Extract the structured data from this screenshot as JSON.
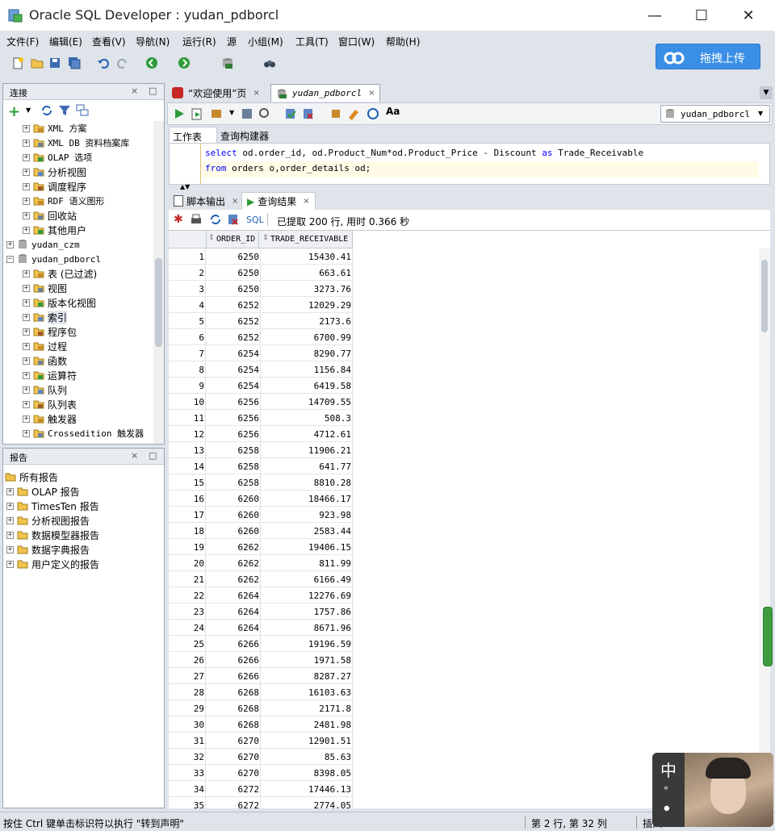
{
  "window": {
    "title": "Oracle SQL Developer : yudan_pdborcl"
  },
  "menu": [
    "文件(F)",
    "编辑(E)",
    "查看(V)",
    "导航(N)",
    "运行(R)",
    "源",
    "小组(M)",
    "工具(T)",
    "窗口(W)",
    "帮助(H)"
  ],
  "baidu_button": "拖拽上传",
  "connections": {
    "title": "连接",
    "items": [
      {
        "label": "XML 方案",
        "level": 2
      },
      {
        "label": "XML DB 资料档案库",
        "level": 2
      },
      {
        "label": "OLAP 选项",
        "level": 2
      },
      {
        "label": "分析视图",
        "level": 2
      },
      {
        "label": "调度程序",
        "level": 2
      },
      {
        "label": "RDF 语义图形",
        "level": 2
      },
      {
        "label": "回收站",
        "level": 2
      },
      {
        "label": "其他用户",
        "level": 2
      },
      {
        "label": "yudan_czm",
        "level": 1
      },
      {
        "label": "yudan_pdborcl",
        "level": 1
      },
      {
        "label": "表 (已过滤)",
        "level": 2
      },
      {
        "label": "视图",
        "level": 2
      },
      {
        "label": "版本化视图",
        "level": 2
      },
      {
        "label": "索引",
        "level": 2
      },
      {
        "label": "程序包",
        "level": 2
      },
      {
        "label": "过程",
        "level": 2
      },
      {
        "label": "函数",
        "level": 2
      },
      {
        "label": "运算符",
        "level": 2
      },
      {
        "label": "队列",
        "level": 2
      },
      {
        "label": "队列表",
        "level": 2
      },
      {
        "label": "触发器",
        "level": 2
      },
      {
        "label": "Crossedition 触发器",
        "level": 2
      }
    ]
  },
  "reports": {
    "title": "报告",
    "root": "所有报告",
    "items": [
      "OLAP 报告",
      "TimesTen 报告",
      "分析视图报告",
      "数据模型器报告",
      "数据字典报告",
      "用户定义的报告"
    ]
  },
  "editor_tabs": {
    "welcome": "“欢迎使用”页",
    "active": "yudan_pdborcl"
  },
  "connection_select": "yudan_pdborcl",
  "worksheet_tabs": {
    "worksheet": "工作表",
    "query_builder": "查询构建器"
  },
  "sql": {
    "line1_kw1": "select",
    "line1_rest": " od.order_id, od.Product_Num*od.Product_Price - Discount ",
    "line1_kw2": "as",
    "line1_end": " Trade_Receivable",
    "line2_kw": "from",
    "line2_rest": " orders o,order_details od;"
  },
  "result_tabs": {
    "script_output": "脚本输出",
    "query_result": "查询结果"
  },
  "result_toolbar": {
    "sql_label": "SQL",
    "status": "已提取 200 行, 用时 0.366 秒"
  },
  "columns": [
    "ORDER_ID",
    "TRADE_RECEIVABLE"
  ],
  "rows": [
    [
      "1",
      "6250",
      "15430.41"
    ],
    [
      "2",
      "6250",
      "663.61"
    ],
    [
      "3",
      "6250",
      "3273.76"
    ],
    [
      "4",
      "6252",
      "12029.29"
    ],
    [
      "5",
      "6252",
      "2173.6"
    ],
    [
      "6",
      "6252",
      "6700.99"
    ],
    [
      "7",
      "6254",
      "8290.77"
    ],
    [
      "8",
      "6254",
      "1156.84"
    ],
    [
      "9",
      "6254",
      "6419.58"
    ],
    [
      "10",
      "6256",
      "14709.55"
    ],
    [
      "11",
      "6256",
      "508.3"
    ],
    [
      "12",
      "6256",
      "4712.61"
    ],
    [
      "13",
      "6258",
      "11906.21"
    ],
    [
      "14",
      "6258",
      "641.77"
    ],
    [
      "15",
      "6258",
      "8810.28"
    ],
    [
      "16",
      "6260",
      "18466.17"
    ],
    [
      "17",
      "6260",
      "923.98"
    ],
    [
      "18",
      "6260",
      "2583.44"
    ],
    [
      "19",
      "6262",
      "19406.15"
    ],
    [
      "20",
      "6262",
      "811.99"
    ],
    [
      "21",
      "6262",
      "6166.49"
    ],
    [
      "22",
      "6264",
      "12276.69"
    ],
    [
      "23",
      "6264",
      "1757.86"
    ],
    [
      "24",
      "6264",
      "8671.96"
    ],
    [
      "25",
      "6266",
      "19196.59"
    ],
    [
      "26",
      "6266",
      "1971.58"
    ],
    [
      "27",
      "6266",
      "8287.27"
    ],
    [
      "28",
      "6268",
      "16103.63"
    ],
    [
      "29",
      "6268",
      "2171.8"
    ],
    [
      "30",
      "6268",
      "2481.98"
    ],
    [
      "31",
      "6270",
      "12901.51"
    ],
    [
      "32",
      "6270",
      "85.63"
    ],
    [
      "33",
      "6270",
      "8398.05"
    ],
    [
      "34",
      "6272",
      "17446.13"
    ],
    [
      "35",
      "6272",
      "2774.05"
    ]
  ],
  "status": {
    "hint": "按住 Ctrl 键单击标识符以执行 \"转到声明\"",
    "position": "第 2 行, 第 32 列",
    "mode": "插入"
  },
  "ime": {
    "char1": "中",
    "char2": "°"
  },
  "colors": {
    "accent": "#3a8ee6",
    "keyword": "#0000ff",
    "bg": "#dfe3ea"
  }
}
